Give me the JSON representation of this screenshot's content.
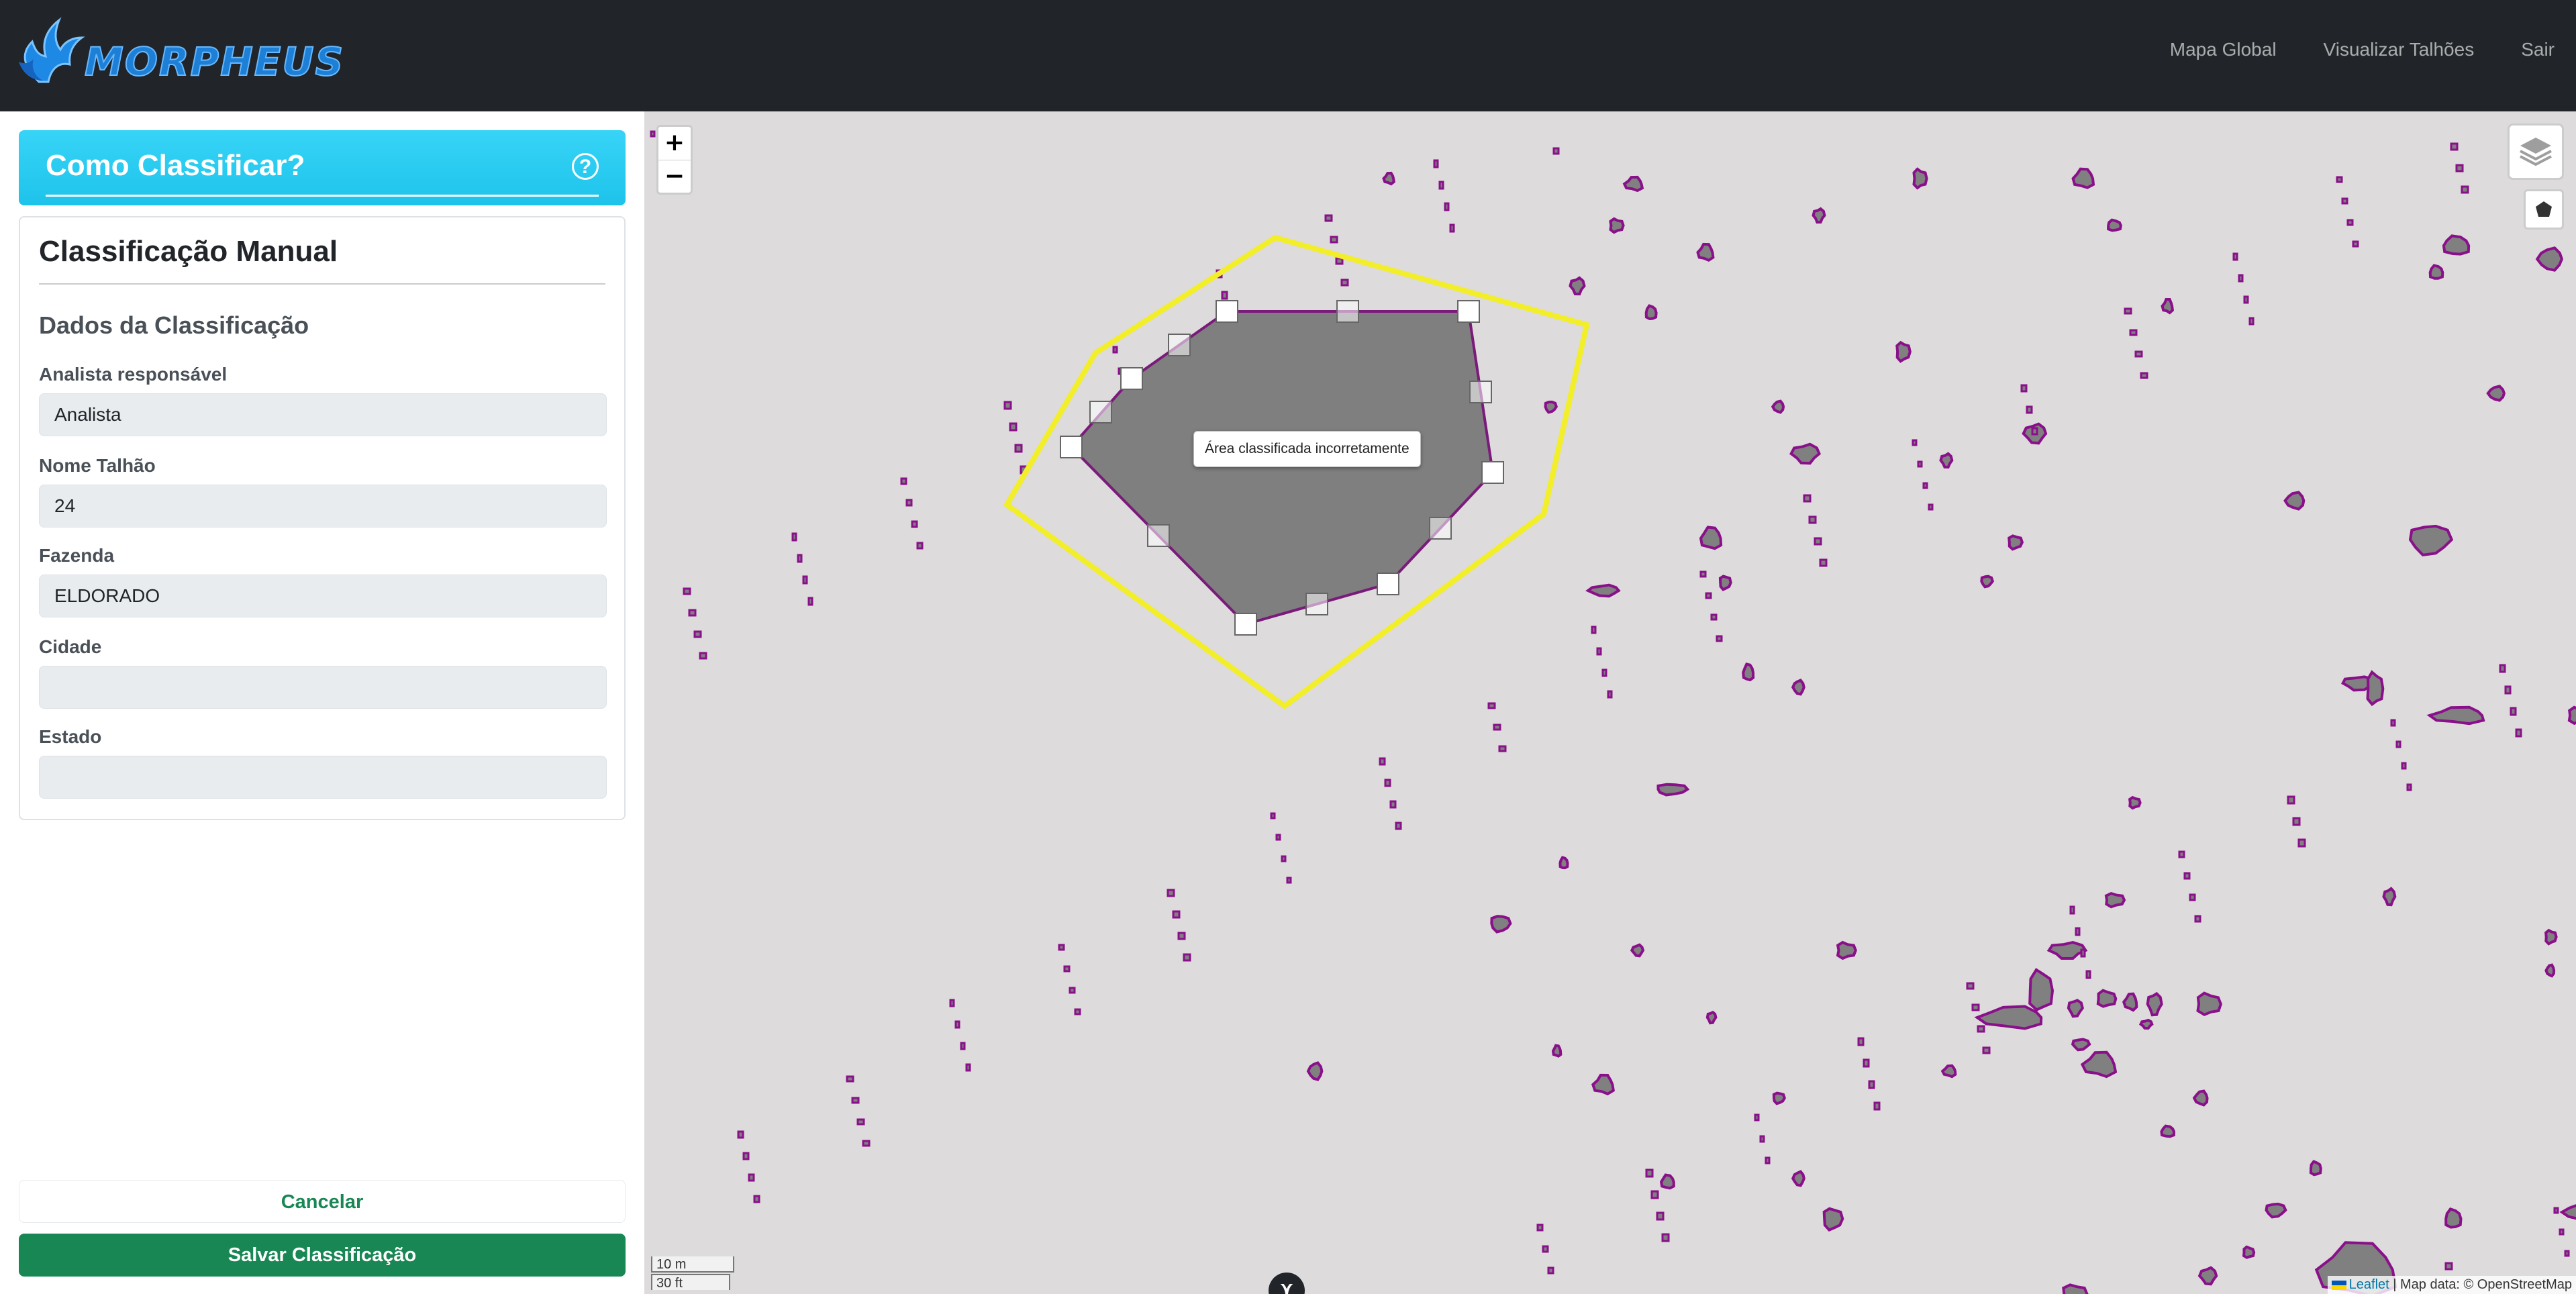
{
  "navbar": {
    "logo_text": "MORPHEUS",
    "links": [
      "Mapa Global",
      "Visualizar Talhões",
      "Sair"
    ]
  },
  "help_card": {
    "title": "Como Classificar?",
    "icon": "question-circle-icon"
  },
  "form": {
    "title": "Classificação Manual",
    "section_title": "Dados da Classificação",
    "fields": [
      {
        "label": "Analista responsável",
        "value": "Analista"
      },
      {
        "label": "Nome Talhão",
        "value": "24"
      },
      {
        "label": "Fazenda",
        "value": "ELDORADO"
      },
      {
        "label": "Cidade",
        "value": ""
      },
      {
        "label": "Estado",
        "value": ""
      }
    ]
  },
  "buttons": {
    "cancel": "Cancelar",
    "save": "Salvar Classificação"
  },
  "map": {
    "zoom_in": "+",
    "zoom_out": "−",
    "tooltip": "Área classificada incorretamente",
    "scale_metric": "10 m",
    "scale_imperial": "30 ft",
    "attribution_leaflet": "Leaflet",
    "attribution_rest": " | Map data: © OpenStreetMap",
    "layers_icon": "layers-icon",
    "draw_icon": "polygon-draw-icon",
    "compass_icon": "compass-icon",
    "colors": {
      "background": "#dddbdb",
      "blob_fill": "#808080",
      "blob_stroke": "#8a0f8a",
      "selection_outline": "#f2ee2a"
    }
  },
  "colors": {
    "navbar": "#212529",
    "help_gradient": "#1ec3ea",
    "save_button": "#198754"
  }
}
